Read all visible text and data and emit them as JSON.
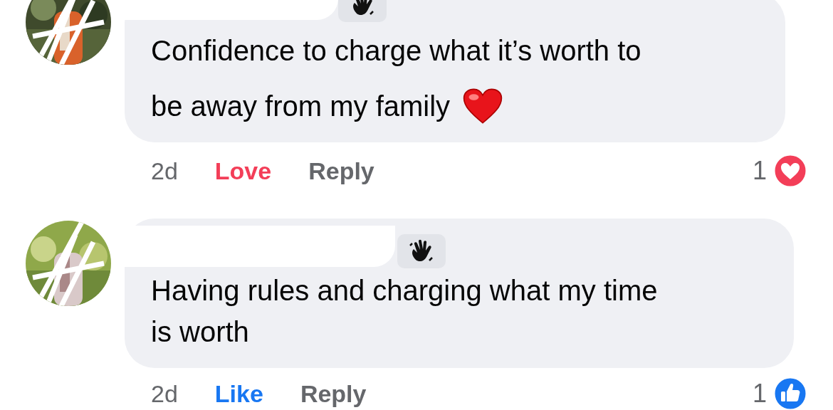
{
  "comments": [
    {
      "badge": {
        "kind": "wave"
      },
      "text_lines": [
        "Confidence to charge what it’s worth to",
        "be away from my family"
      ],
      "trailing_emoji": {
        "kind": "heart"
      },
      "time": "2d",
      "reaction_button": {
        "kind": "love",
        "label": "Love"
      },
      "reply": "Reply",
      "reactions": {
        "count": "1",
        "kind": "love"
      }
    },
    {
      "badge": {
        "kind": "wave"
      },
      "text_lines": [
        "Having rules and charging what my time",
        "is worth"
      ],
      "time": "2d",
      "reaction_button": {
        "kind": "like",
        "label": "Like"
      },
      "reply": "Reply",
      "reactions": {
        "count": "1",
        "kind": "like"
      }
    }
  ]
}
